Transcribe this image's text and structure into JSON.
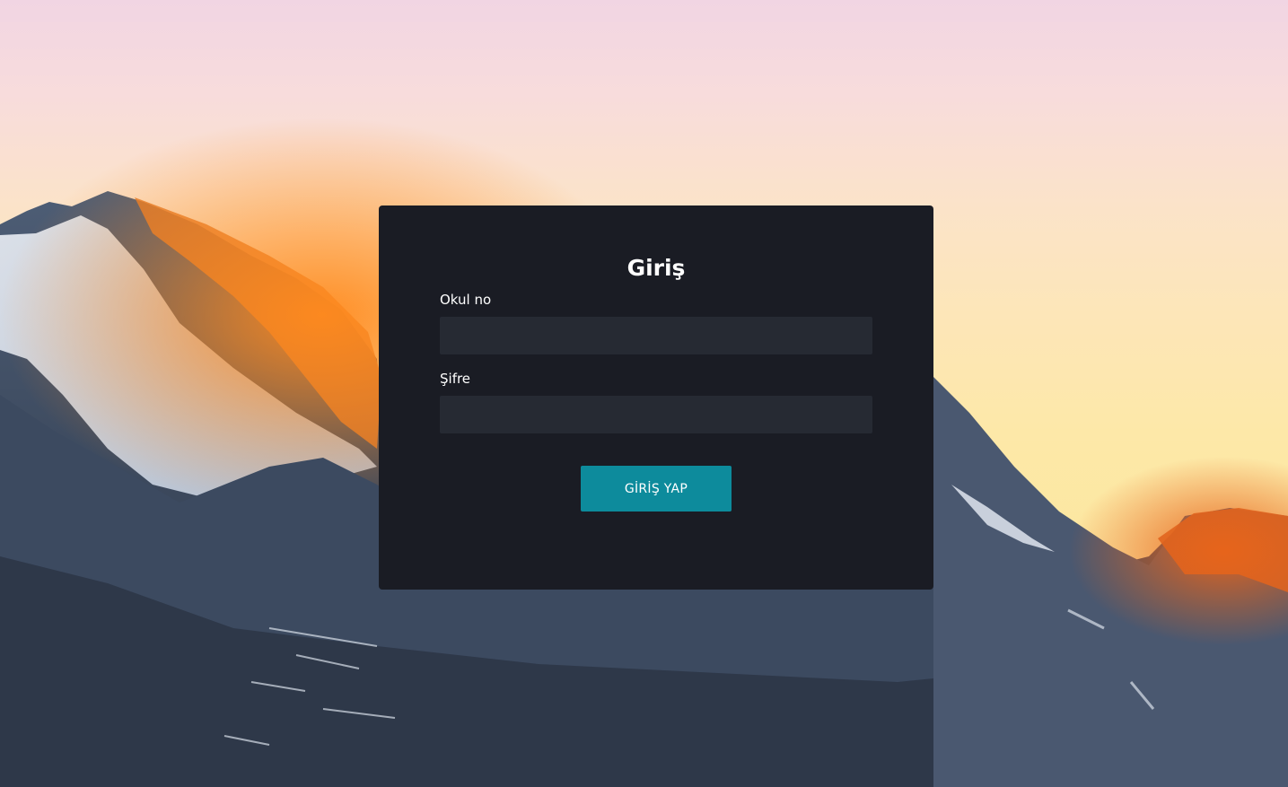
{
  "login": {
    "title": "Giriş",
    "username_label": "Okul no",
    "username_value": "",
    "password_label": "Şifre",
    "password_value": "",
    "submit_label": "GİRİŞ YAP"
  },
  "colors": {
    "card_bg": "#1a1c24",
    "input_bg": "#262a33",
    "button_bg": "#0d8b9c",
    "text": "#ffffff"
  }
}
